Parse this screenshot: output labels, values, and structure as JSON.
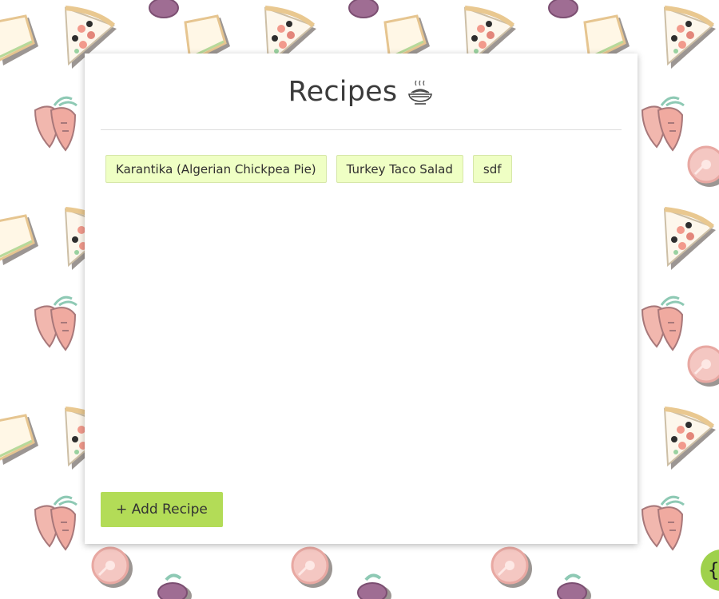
{
  "header": {
    "title": "Recipes",
    "title_icon": "noodle-bowl-icon"
  },
  "recipes": [
    {
      "name": "Karantika (Algerian Chickpea Pie)"
    },
    {
      "name": "Turkey Taco Salad"
    },
    {
      "name": "sdf"
    }
  ],
  "actions": {
    "add_recipe_label": "+ Add Recipe"
  },
  "fab": {
    "label": "{",
    "icon": "code-brace-icon"
  },
  "background": {
    "pattern_icons": [
      "pizza-slice-icon",
      "sandwich-icon",
      "carrot-icon",
      "ham-steak-icon",
      "eggplant-icon",
      "plum-icon"
    ]
  },
  "colors": {
    "tag_bg": "#efffc4",
    "button_bg": "#b3dc57",
    "title_text": "#3b3b3b"
  }
}
